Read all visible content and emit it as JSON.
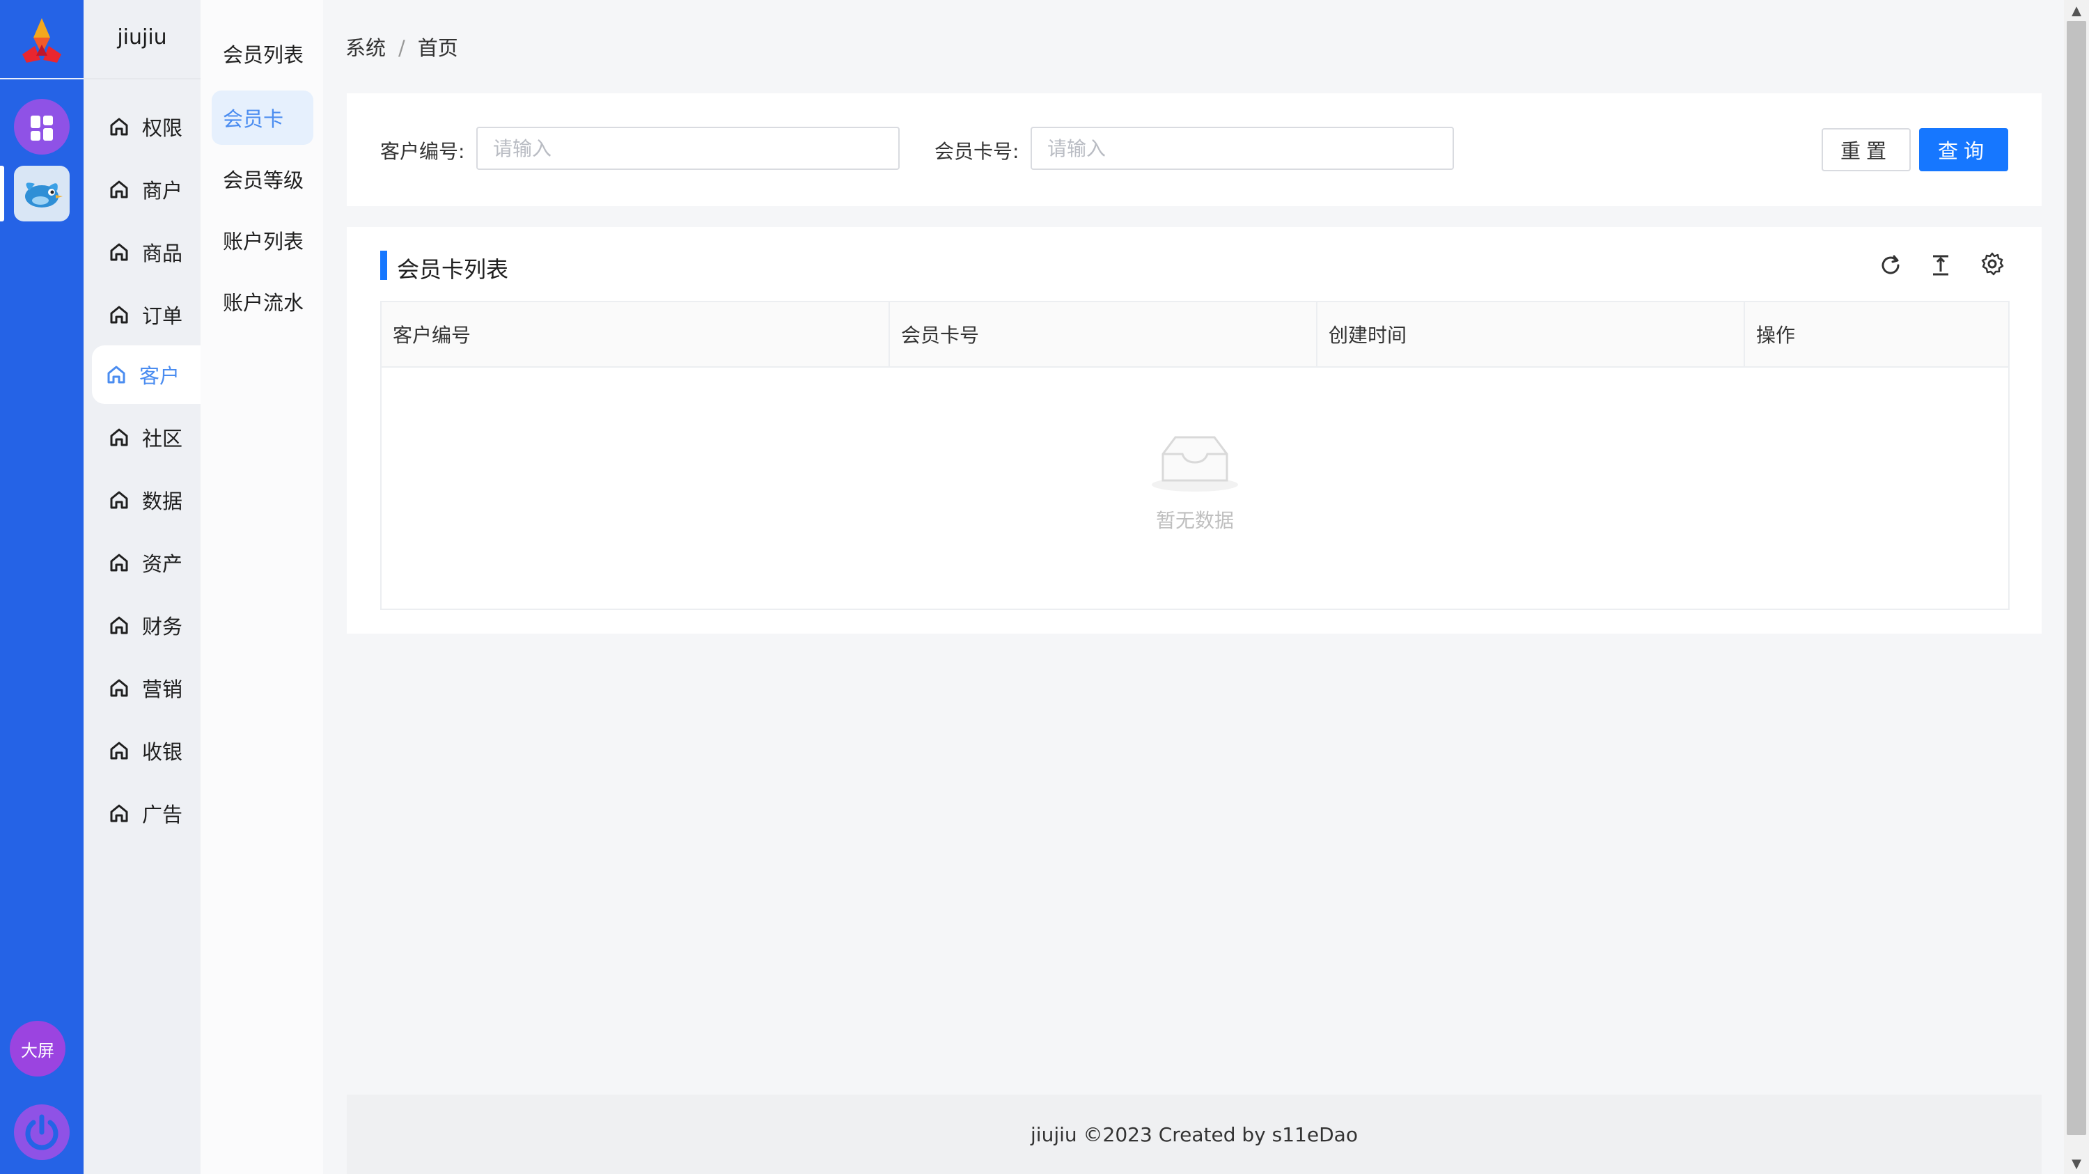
{
  "app": {
    "brand": "jiujiu",
    "rail": {
      "big_screen_label": "大屏"
    }
  },
  "primary_menu": [
    {
      "label": "权限",
      "icon": "home-icon"
    },
    {
      "label": "商户",
      "icon": "home-icon"
    },
    {
      "label": "商品",
      "icon": "home-icon"
    },
    {
      "label": "订单",
      "icon": "home-icon"
    },
    {
      "label": "客户",
      "icon": "home-icon",
      "active": true
    },
    {
      "label": "社区",
      "icon": "home-icon"
    },
    {
      "label": "数据",
      "icon": "home-icon"
    },
    {
      "label": "资产",
      "icon": "home-icon"
    },
    {
      "label": "财务",
      "icon": "home-icon"
    },
    {
      "label": "营销",
      "icon": "home-icon"
    },
    {
      "label": "收银",
      "icon": "home-icon"
    },
    {
      "label": "广告",
      "icon": "home-icon"
    }
  ],
  "secondary_menu": [
    {
      "label": "会员列表"
    },
    {
      "label": "会员卡",
      "active": true
    },
    {
      "label": "会员等级"
    },
    {
      "label": "账户列表"
    },
    {
      "label": "账户流水"
    }
  ],
  "breadcrumb": {
    "items": [
      "系统",
      "首页"
    ],
    "separator": "/"
  },
  "search": {
    "customer_no_label": "客户编号:",
    "customer_no_placeholder": "请输入",
    "card_no_label": "会员卡号:",
    "card_no_placeholder": "请输入",
    "reset_label": "重置",
    "query_label": "查询"
  },
  "table": {
    "title": "会员卡列表",
    "columns": [
      "客户编号",
      "会员卡号",
      "创建时间",
      "操作"
    ],
    "rows": [],
    "empty_text": "暂无数据",
    "toolbar_icons": [
      "refresh-icon",
      "column-height-icon",
      "settings-icon"
    ]
  },
  "footer": {
    "text": "jiujiu ©2023 Created by s11eDao"
  },
  "colors": {
    "rail": "#2563e6",
    "accent": "#1677ff",
    "menu_active_text": "#4a8cf0",
    "purple": "#8f52e6"
  }
}
